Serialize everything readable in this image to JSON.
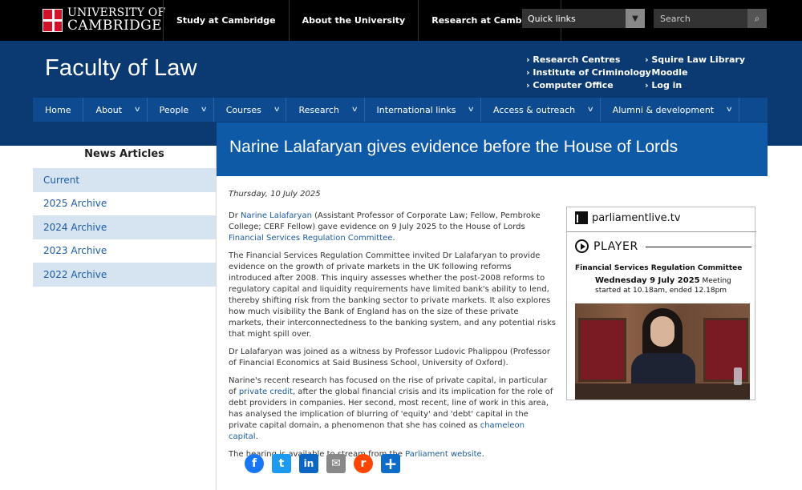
{
  "topbar": {
    "logo_line1": "UNIVERSITY OF",
    "logo_line2": "CAMBRIDGE",
    "nav": [
      "Study at Cambridge",
      "About the University",
      "Research at Cambridge"
    ],
    "quick_links": "Quick links",
    "search_placeholder": "Search"
  },
  "header": {
    "title": "Faculty of Law",
    "links_col1": [
      "Research Centres",
      "Institute of Criminology",
      "Computer Office"
    ],
    "links_col2": [
      "Squire Law Library",
      "Moodle",
      "Log in"
    ]
  },
  "mainnav": [
    "Home",
    "About",
    "People",
    "Courses",
    "Research",
    "International links",
    "Access & outreach",
    "Alumni & development"
  ],
  "sidebar": {
    "title": "News Articles",
    "items": [
      "Current",
      "2025 Archive",
      "2024 Archive",
      "2023 Archive",
      "2022 Archive"
    ]
  },
  "article": {
    "title": "Narine Lalafaryan gives evidence before the House of Lords",
    "date": "Thursday, 10 July 2025",
    "p1_pre": "Dr ",
    "p1_link1": "Narine Lalafaryan",
    "p1_mid": " (Assistant Professor of Corporate Law; Fellow, Pembroke College; CERF Fellow) gave evidence on 9 July 2025 to the House of Lords ",
    "p1_link2": "Financial Services Regulation Committee",
    "p1_post": ".",
    "p2": "The Financial Services Regulation Committee invited Dr Lalafaryan to provide evidence on the growth of private markets in the UK following reforms introduced after 2008. This inquiry assesses whether the post-2008 reforms to regulatory capital and liquidity requirements have limited bank's ability to lend, thereby shifting risk from the banking sector to private markets. It also explores how much visibility the Bank of England has on the size of these private markets, their interconnectedness to the banking system, and any potential risks that might spill over.",
    "p3": "Dr Lalafaryan was joined as a witness by Professor Ludovic Phalippou (Professor of Financial Economics at Said Business School, University of Oxford).",
    "p4_pre": "Narine's recent research has focused on the rise of private capital, in particular of ",
    "p4_link1": "private credit",
    "p4_mid": ", after the global financial crisis and its implication for the role of debt providers in companies. Her second, most recent, line of work in this area, has analysed the implication of blurring of 'equity' and 'debt' capital in the private capital domain, a phenomenon that she has coined as ",
    "p4_link2": "chameleon capital",
    "p4_post": ".",
    "p5_pre": "The hearing is available to stream from the ",
    "p5_link": "Parliament website",
    "p5_post": "."
  },
  "widget": {
    "brand": "parliamentlive.tv",
    "player": "PLAYER",
    "committee": "Financial Services Regulation Committee",
    "date_bold": "Wednesday 9 July 2025",
    "date_rest": " Meeting started at 10.18am, ended 12.18pm"
  },
  "social": [
    "f",
    "t",
    "in",
    "✉",
    "r",
    "+"
  ]
}
